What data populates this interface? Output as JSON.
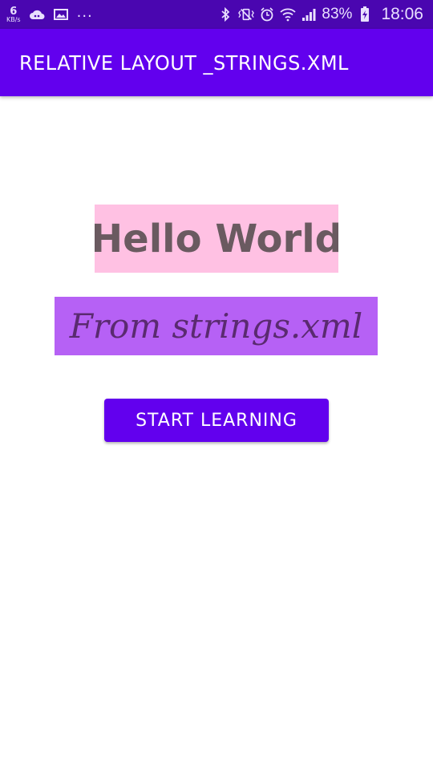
{
  "status_bar": {
    "network_speed": "6",
    "network_unit": "KB/s",
    "more_indicator": "...",
    "battery_percent": "83%",
    "time": "18:06",
    "icons": [
      "cloud-icon",
      "image-icon",
      "bluetooth-icon",
      "vibrate-icon",
      "alarm-icon",
      "wifi-icon",
      "signal-icon",
      "battery-charging-icon"
    ]
  },
  "app_bar": {
    "title": "RELATIVE LAYOUT _STRINGS.XML",
    "color": "#6200ee"
  },
  "content": {
    "hello_text": "Hello World",
    "hello_bg": "#ffc1e3",
    "from_text": "From strings.xml",
    "from_bg": "#b661f5",
    "button_label": "START LEARNING"
  }
}
